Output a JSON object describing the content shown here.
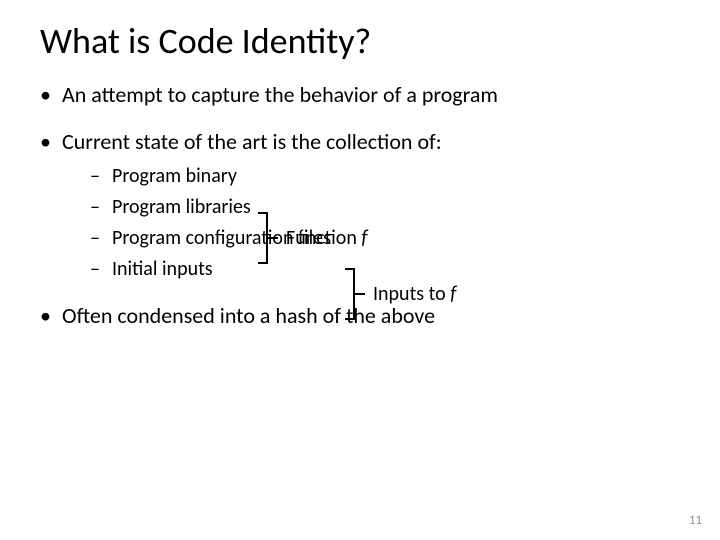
{
  "title": "What is Code Identity?",
  "bullets": {
    "b1": "An attempt to capture the behavior of a program",
    "b2": "Current state of the art is the collection of:",
    "sub1": "Program binary",
    "sub2": "Program libraries",
    "sub3": "Program configuration files",
    "sub4": "Initial inputs",
    "b3": "Often condensed into a hash of the above"
  },
  "annotations": {
    "func_prefix": "Function ",
    "func_var": "f",
    "inputs_prefix": "Inputs to ",
    "inputs_var": "f"
  },
  "page_number": "11"
}
